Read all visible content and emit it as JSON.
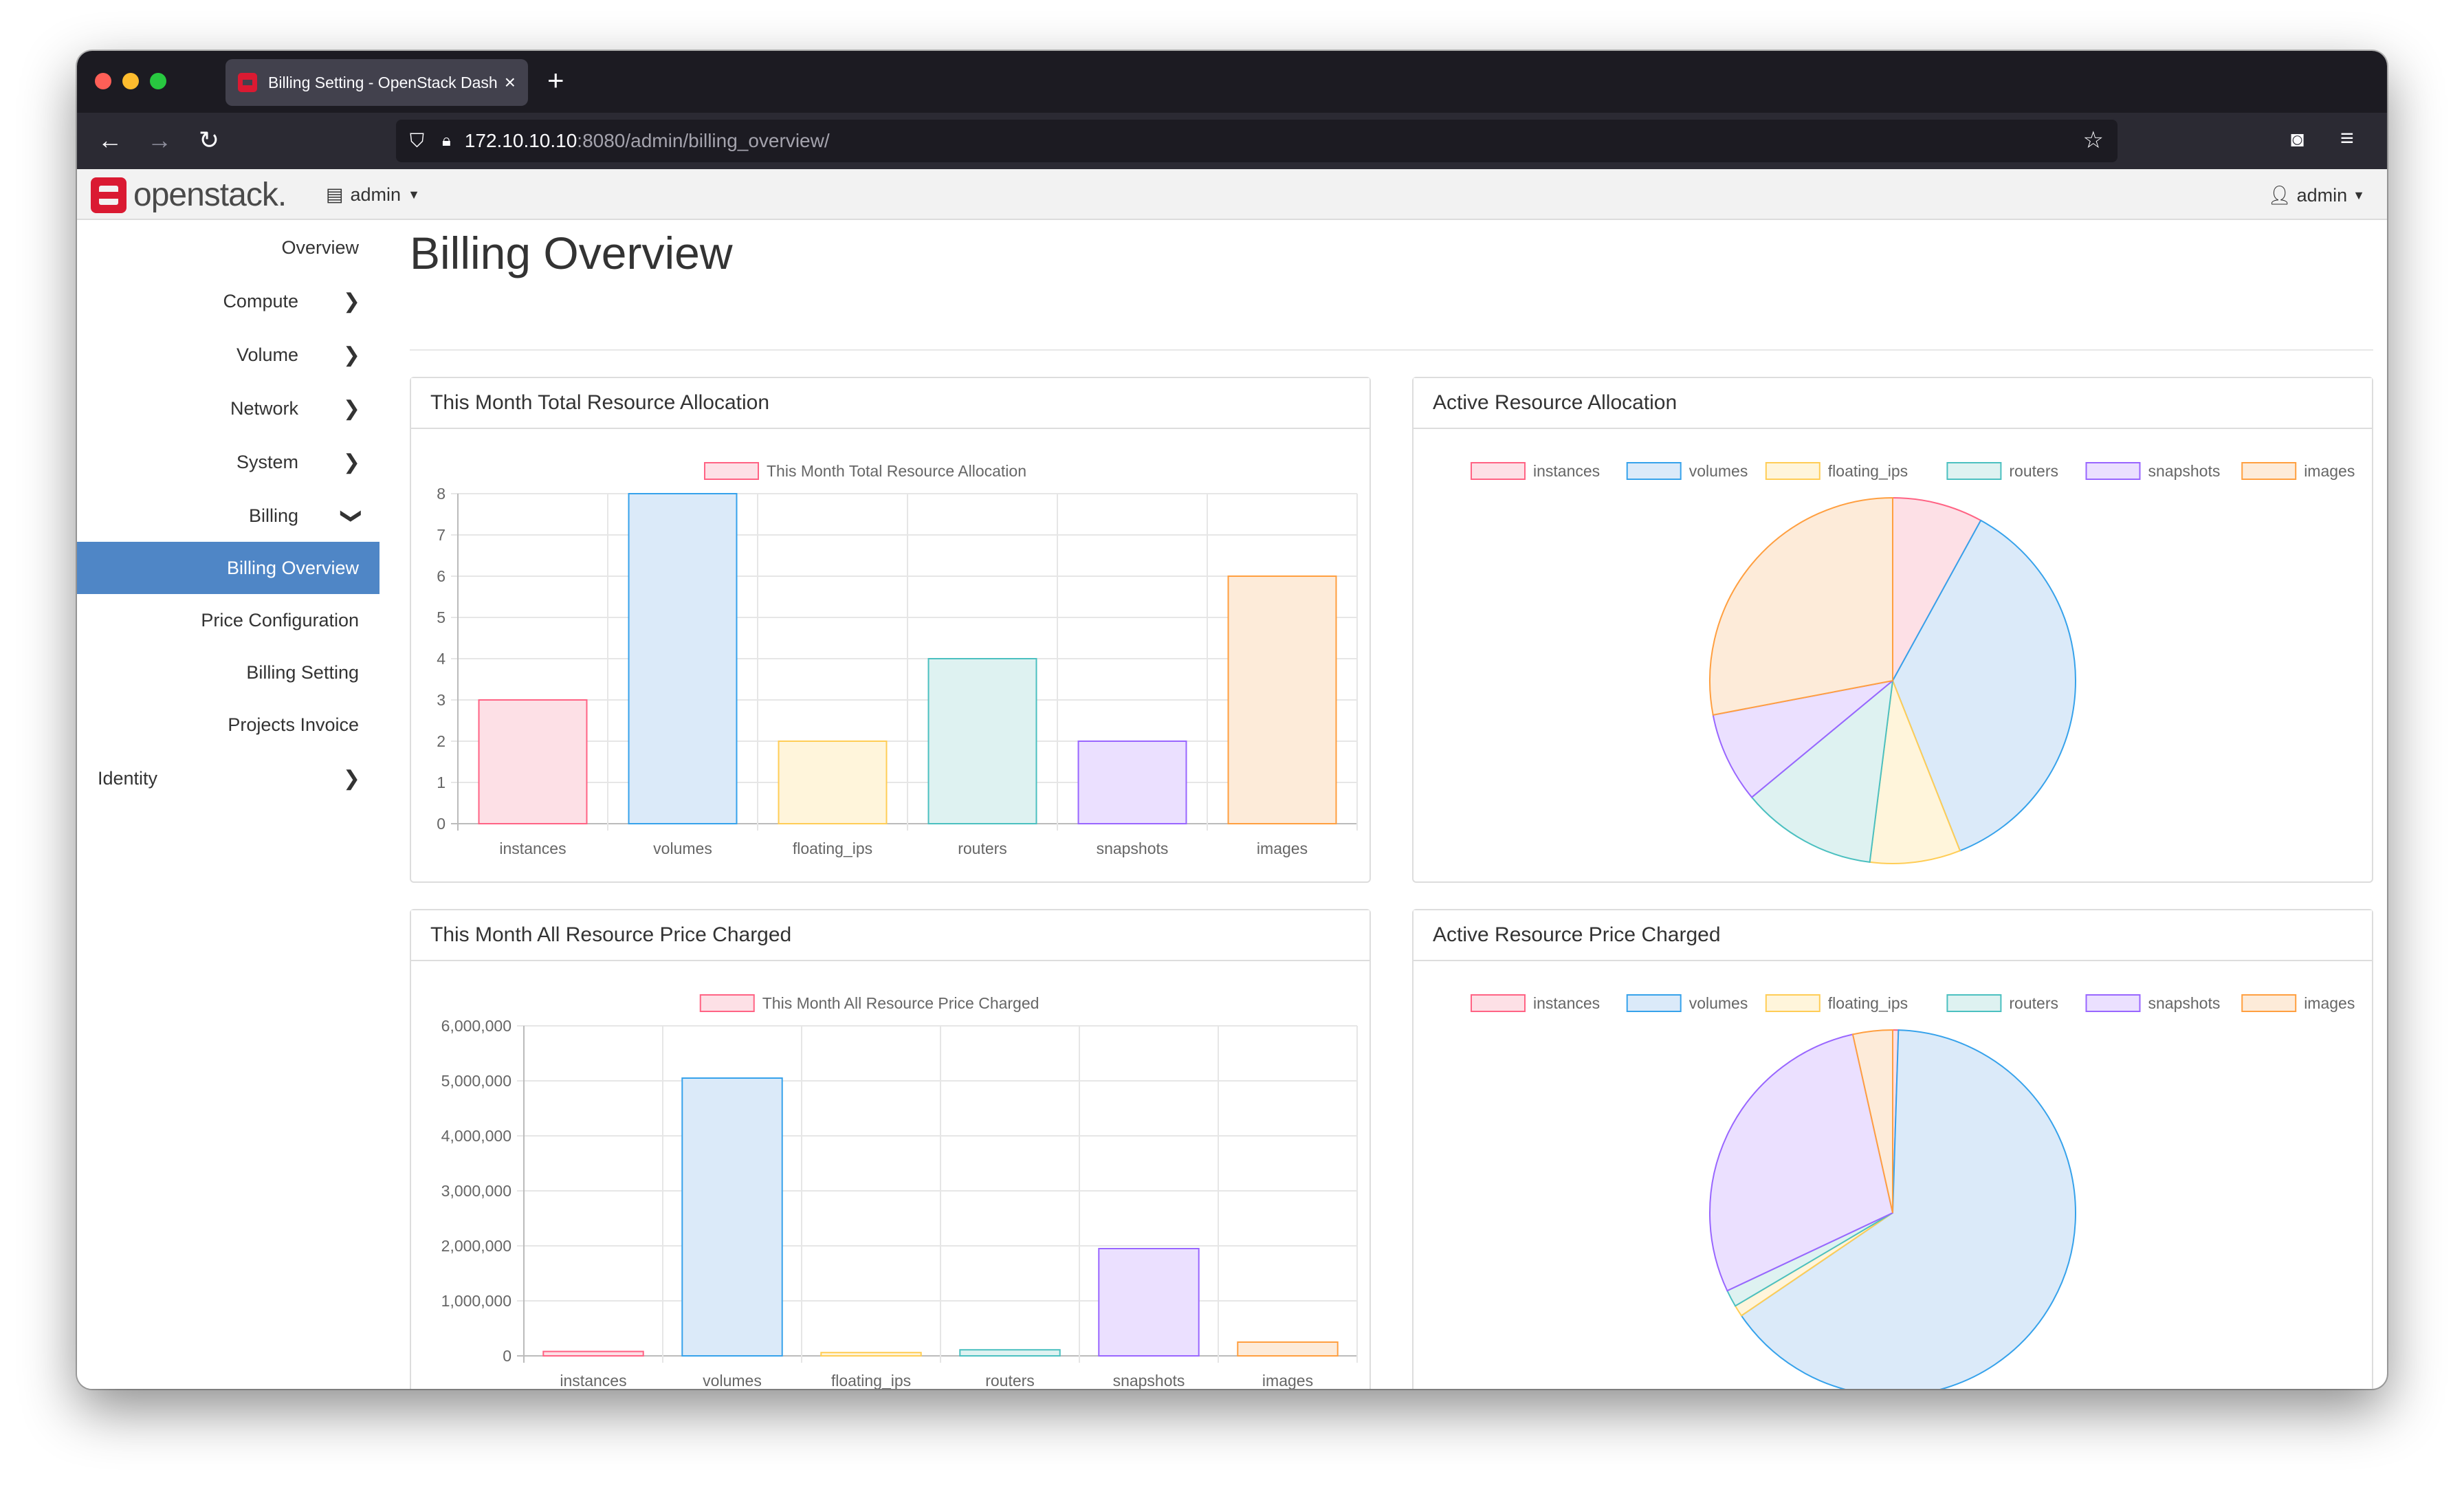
{
  "browser": {
    "tab_title": "Billing Setting - OpenStack Dash",
    "url_host": "172.10.10.10",
    "url_path": ":8080/admin/billing_overview/"
  },
  "header": {
    "logo_text": "openstack.",
    "project": "admin",
    "user": "admin"
  },
  "sidebar": {
    "items": [
      {
        "label": "Overview"
      },
      {
        "label": "Compute"
      },
      {
        "label": "Volume"
      },
      {
        "label": "Network"
      },
      {
        "label": "System"
      },
      {
        "label": "Billing"
      },
      {
        "label": "Billing Overview"
      },
      {
        "label": "Price Configuration"
      },
      {
        "label": "Billing Setting"
      },
      {
        "label": "Projects Invoice"
      },
      {
        "label": "Identity"
      }
    ]
  },
  "page": {
    "title": "Billing Overview"
  },
  "colors": {
    "fills": [
      "#fde0e6",
      "#dbeaf9",
      "#fff5db",
      "#def2f1",
      "#ebe0ff",
      "#fdebd9"
    ],
    "borders": [
      "#ff6384",
      "#36a2eb",
      "#ffcd56",
      "#4bc0c0",
      "#9966ff",
      "#ff9f40"
    ]
  },
  "panels": [
    {
      "title": "This Month Total Resource Allocation"
    },
    {
      "title": "Active Resource Allocation"
    },
    {
      "title": "This Month All Resource Price Charged"
    },
    {
      "title": "Active Resource Price Charged"
    }
  ],
  "chart_data": [
    {
      "type": "bar",
      "title": "This Month Total Resource Allocation",
      "categories": [
        "instances",
        "volumes",
        "floating_ips",
        "routers",
        "snapshots",
        "images"
      ],
      "series": [
        {
          "name": "This Month Total Resource Allocation",
          "values": [
            3,
            8,
            2,
            4,
            2,
            6
          ]
        }
      ],
      "ylim": [
        0,
        8
      ],
      "yticks": [
        "0",
        "1",
        "2",
        "3",
        "4",
        "5",
        "6",
        "7",
        "8"
      ],
      "grid": true,
      "legend": "top"
    },
    {
      "type": "pie",
      "title": "Active Resource Allocation",
      "labels": [
        "instances",
        "volumes",
        "floating_ips",
        "routers",
        "snapshots",
        "images"
      ],
      "values": [
        2,
        9,
        2,
        3,
        2,
        7
      ],
      "legend": "top"
    },
    {
      "type": "bar",
      "title": "This Month All Resource Price Charged",
      "categories": [
        "instances",
        "volumes",
        "floating_ips",
        "routers",
        "snapshots",
        "images"
      ],
      "series": [
        {
          "name": "This Month All Resource Price Charged",
          "values": [
            80000,
            5050000,
            60000,
            110000,
            1950000,
            250000
          ]
        }
      ],
      "ylim": [
        0,
        6000000
      ],
      "yticks": [
        "0",
        "1,000,000",
        "2,000,000",
        "3,000,000",
        "4,000,000",
        "5,000,000",
        "6,000,000"
      ],
      "grid": true,
      "legend": "top"
    },
    {
      "type": "pie",
      "title": "Active Resource Price Charged",
      "labels": [
        "instances",
        "volumes",
        "floating_ips",
        "routers",
        "snapshots",
        "images"
      ],
      "values": [
        0.5,
        65,
        1,
        1.5,
        28.5,
        3.5
      ],
      "legend": "top"
    }
  ]
}
